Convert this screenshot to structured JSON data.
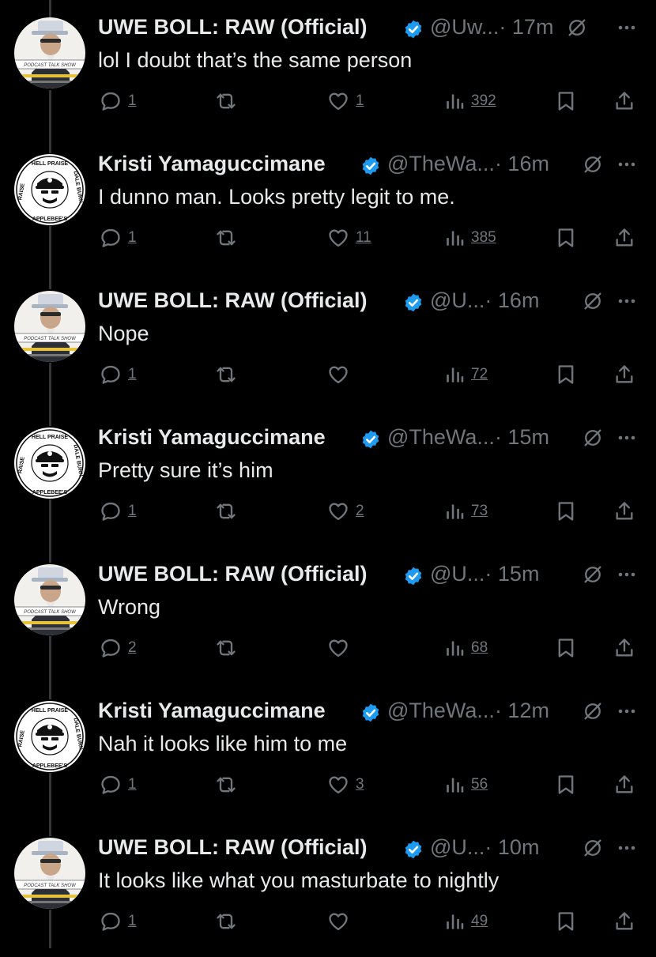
{
  "colors": {
    "background": "#000000",
    "text_primary": "#e7e9ea",
    "text_secondary": "#71767b",
    "verified": "#1d9bf0",
    "thread_line": "#333639"
  },
  "icons": {
    "verified": "verified-badge-icon",
    "mute": "mute-icon",
    "more": "more-icon",
    "reply": "reply-icon",
    "retweet": "retweet-icon",
    "like": "like-icon",
    "views": "views-icon",
    "bookmark": "bookmark-icon",
    "share": "share-icon"
  },
  "tweets": [
    {
      "name": "UWE BOLL: RAW (Official)",
      "handle": "@Uw...",
      "time": "· 17m",
      "text": "lol I doubt that’s the same person",
      "replies": "1",
      "retweets": "",
      "likes": "1",
      "views": "392",
      "avatar_label": "PODCAST TALK SHOW"
    },
    {
      "name": "Kristi Yamaguccimane",
      "handle": "@TheWa...",
      "time": "· 16m",
      "text": "I dunno man. Looks pretty legit to me.",
      "replies": "1",
      "retweets": "",
      "likes": "11",
      "views": "385",
      "avatar_label": "RAISE HELL PRAISE DALE BURN DOWN APPLEBEE'S"
    },
    {
      "name": "UWE BOLL: RAW (Official)",
      "handle": "@U...",
      "time": "· 16m",
      "text": "Nope",
      "replies": "1",
      "retweets": "",
      "likes": "",
      "views": "72",
      "avatar_label": "PODCAST TALK SHOW"
    },
    {
      "name": "Kristi Yamaguccimane",
      "handle": "@TheWa...",
      "time": "· 15m",
      "text": "Pretty sure it’s him",
      "replies": "1",
      "retweets": "",
      "likes": "2",
      "views": "73",
      "avatar_label": "RAISE HELL PRAISE DALE BURN DOWN APPLEBEE'S"
    },
    {
      "name": "UWE BOLL: RAW (Official)",
      "handle": "@U...",
      "time": "· 15m",
      "text": "Wrong",
      "replies": "2",
      "retweets": "",
      "likes": "",
      "views": "68",
      "avatar_label": "PODCAST TALK SHOW"
    },
    {
      "name": "Kristi Yamaguccimane",
      "handle": "@TheWa...",
      "time": "· 12m",
      "text": "Nah it looks like him to me",
      "replies": "1",
      "retweets": "",
      "likes": "3",
      "views": "56",
      "avatar_label": "RAISE HELL PRAISE DALE BURN DOWN APPLEBEE'S"
    },
    {
      "name": "UWE BOLL: RAW (Official)",
      "handle": "@U...",
      "time": "· 10m",
      "text": "It looks like what you masturbate to nightly",
      "replies": "1",
      "retweets": "",
      "likes": "",
      "views": "49",
      "avatar_label": "PODCAST TALK SHOW"
    }
  ]
}
